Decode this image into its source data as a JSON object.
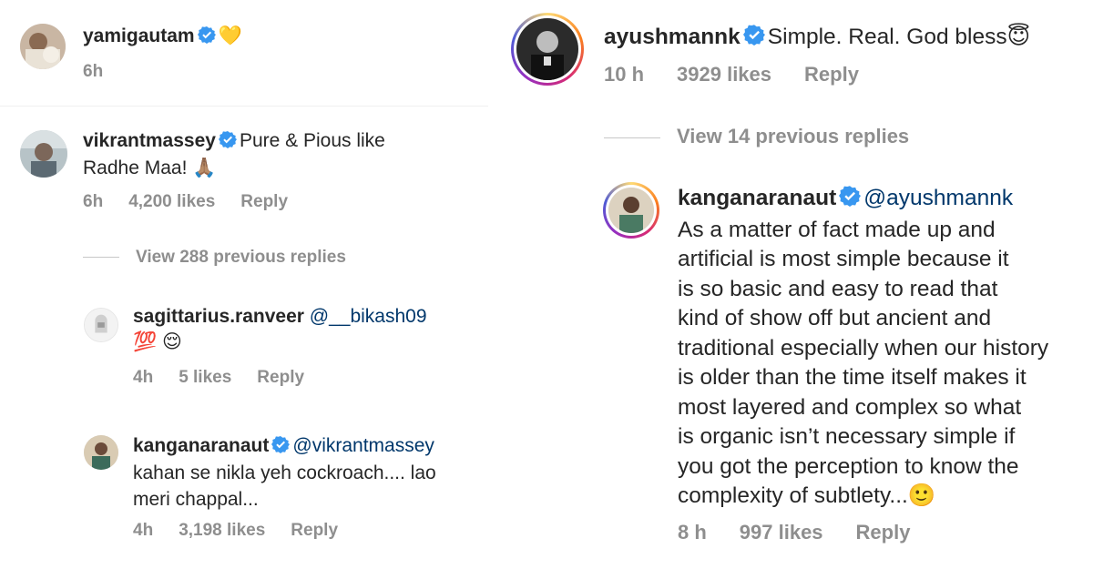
{
  "left": {
    "top_comment": {
      "username": "yamigautam",
      "text": "💛",
      "time": "6h"
    },
    "comment": {
      "username": "vikrantmassey",
      "text_line1": "Pure & Pious like",
      "text_line2": "Radhe Maa! 🙏🏽",
      "time": "6h",
      "likes": "4,200 likes",
      "reply": "Reply"
    },
    "view_replies": "View 288 previous replies",
    "reply1": {
      "username": "sagittarius.ranveer",
      "mention": "@__bikash09",
      "text": "💯 😌",
      "time": "4h",
      "likes": "5 likes",
      "reply": "Reply"
    },
    "reply2": {
      "username": "kanganaranaut",
      "mention": "@vikrantmassey",
      "text_line1": "kahan se nikla yeh cockroach.... lao",
      "text_line2": "meri chappal...",
      "time": "4h",
      "likes": "3,198 likes",
      "reply": "Reply"
    }
  },
  "right": {
    "comment": {
      "username": "ayushmannk",
      "text": "Simple. Real. God bless😇",
      "time": "10 h",
      "likes": "3929 likes",
      "reply": "Reply"
    },
    "view_replies": "View 14 previous replies",
    "reply": {
      "username": "kanganaranaut",
      "mention": "@ayushmannk",
      "lines": [
        "As a matter of fact made up and",
        "artificial is most simple because it",
        "is so basic and easy to read that",
        "kind of show off but ancient and",
        "traditional especially when our history",
        "is older than the time itself makes it",
        "most layered and complex so what",
        "is organic isn’t necessary simple if",
        "you got the perception to know the",
        "complexity of subtlety...🙂"
      ],
      "time": "8 h",
      "likes": "997 likes",
      "reply": "Reply"
    }
  },
  "colors": {
    "verified": "#3897f0",
    "meta": "#8e8e8e",
    "mention": "#00376b",
    "text": "#262626"
  }
}
